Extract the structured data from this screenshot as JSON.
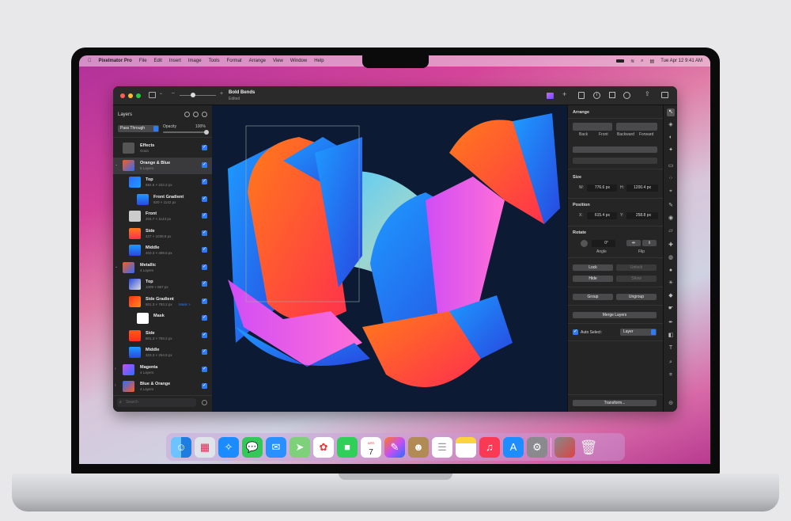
{
  "menubar": {
    "app": "Pixelmator Pro",
    "items": [
      "File",
      "Edit",
      "Insert",
      "Image",
      "Tools",
      "Format",
      "Arrange",
      "View",
      "Window",
      "Help"
    ],
    "datetime": "Tue Apr 12  9:41 AM"
  },
  "document": {
    "title": "Bold Bends",
    "status": "Edited"
  },
  "layers": {
    "title": "Layers",
    "blend_mode": "Pass Through",
    "opacity_label": "Opacity",
    "opacity_value": "100%",
    "opacity": 1.0,
    "items": [
      {
        "name": "Effects",
        "sub": "Grain",
        "indent": 0
      },
      {
        "name": "Orange & Blue",
        "sub": "5 Layers",
        "indent": 0,
        "group": true,
        "expanded": true,
        "selected": true
      },
      {
        "name": "Top",
        "sub": "584.6 × 222.2 px",
        "indent": 1
      },
      {
        "name": "Front Gradient",
        "sub": "820 × 1142 px",
        "indent": 2
      },
      {
        "name": "Front",
        "sub": "204.7 × 1143 px",
        "indent": 1
      },
      {
        "name": "Side",
        "sub": "427 × 1039.6 px",
        "indent": 1
      },
      {
        "name": "Middle",
        "sub": "403.3 × 499.6 px",
        "indent": 1
      },
      {
        "name": "Metallic",
        "sub": "4 Layers",
        "indent": 0,
        "group": true,
        "expanded": true
      },
      {
        "name": "Top",
        "sub": "1009 × 867 px",
        "indent": 1
      },
      {
        "name": "Side Gradient",
        "sub": "801.3 × 793.2 px",
        "indent": 1,
        "extra": "Mask >"
      },
      {
        "name": "Mask",
        "sub": "",
        "indent": 2
      },
      {
        "name": "Side",
        "sub": "801.3 × 793.2 px",
        "indent": 1
      },
      {
        "name": "Middle",
        "sub": "323.3 × 254.8 px",
        "indent": 1
      },
      {
        "name": "Magenta",
        "sub": "4 Layers",
        "indent": 0,
        "group": true
      },
      {
        "name": "Blue & Orange",
        "sub": "4 Layers",
        "indent": 0,
        "group": true
      }
    ],
    "search_placeholder": "Search"
  },
  "arrange": {
    "title": "Arrange",
    "order": [
      "Back",
      "Front",
      "Backward",
      "Forward"
    ],
    "size_title": "Size",
    "w_label": "W:",
    "w": "776.6 px",
    "h_label": "H:",
    "h": "1200.4 px",
    "position_title": "Position",
    "x_label": "X:",
    "x": "615.4 px",
    "y_label": "Y:",
    "y": "258.8 px",
    "rotate_title": "Rotate",
    "angle": "0°",
    "angle_label": "Angle",
    "flip_label": "Flip",
    "lock": "Lock",
    "unlock": "Unlock",
    "hide": "Hide",
    "show": "Show",
    "group": "Group",
    "ungroup": "Ungroup",
    "merge": "Merge Layers",
    "auto_select": "Auto Select:",
    "auto_select_checked": true,
    "auto_select_value": "Layer",
    "transform": "Transform..."
  },
  "calendar": {
    "month": "APR",
    "day": "7"
  },
  "colors": {
    "accent": "#2f7bf5",
    "canvas_bg": "#0c1a33"
  }
}
